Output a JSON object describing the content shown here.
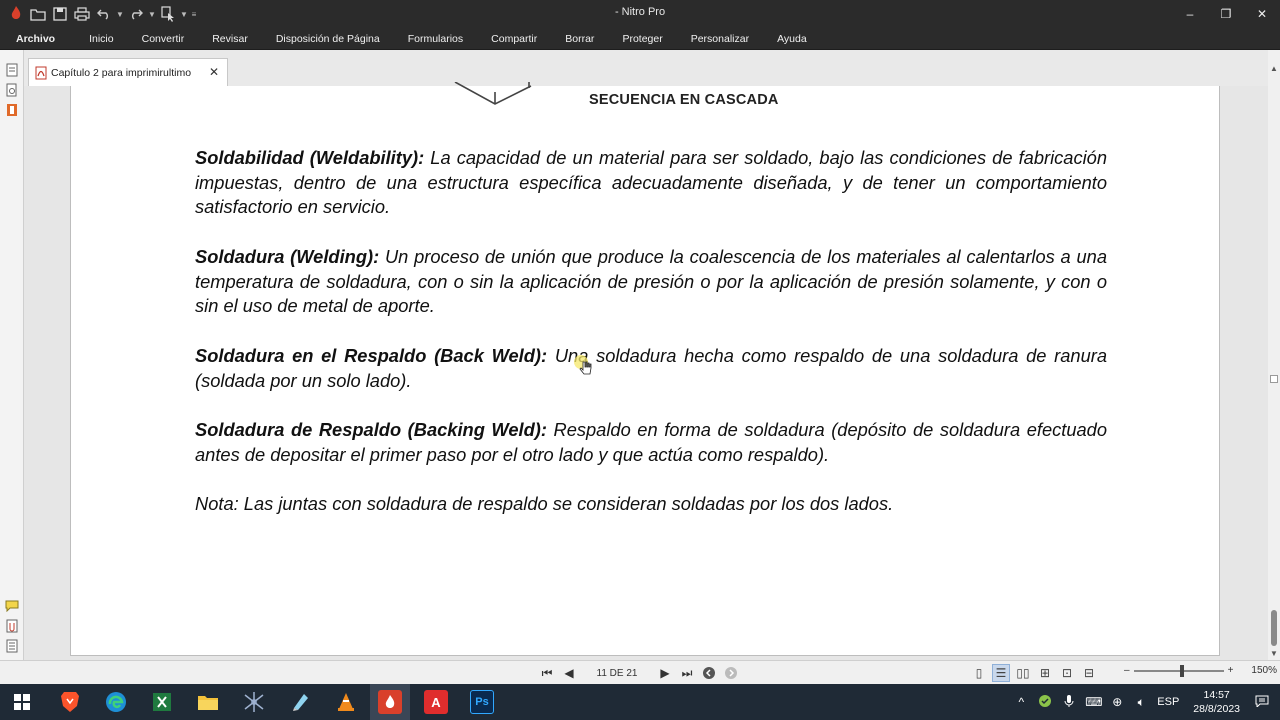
{
  "window": {
    "title": "- Nitro Pro",
    "minimize": "–",
    "restore": "❐",
    "close": "✕"
  },
  "quick_access": {
    "open_icon": "folder-icon",
    "save_icon": "save-icon",
    "print_icon": "print-icon",
    "undo_icon": "undo-icon",
    "redo_icon": "redo-icon",
    "select_icon": "select-tool-icon"
  },
  "menu": {
    "file": "Archivo",
    "items": [
      "Inicio",
      "Convertir",
      "Revisar",
      "Disposición de Página",
      "Formularios",
      "Compartir",
      "Borrar",
      "Proteger",
      "Personalizar",
      "Ayuda"
    ]
  },
  "tab": {
    "label": "Capítulo 2 para imprimirultimo",
    "close": "✕"
  },
  "document": {
    "caption": "SECUENCIA EN CASCADA",
    "paragraphs": [
      {
        "term": "Soldabilidad (Weldability):",
        "text": " La capacidad de un material para ser soldado, bajo las condiciones de fabricación impuestas, dentro de una estructura específica adecuadamente diseñada, y de tener un comportamiento satisfactorio en servicio."
      },
      {
        "term": "Soldadura (Welding):",
        "text": " Un proceso de unión que produce la coalescencia de los materiales al calentarlos a una temperatura de soldadura, con o sin la aplicación de presión o por la aplicación de presión solamente, y con o sin el uso de metal de aporte."
      },
      {
        "term": "Soldadura en el Respaldo (Back Weld):",
        "text": " Una soldadura hecha como respaldo de una soldadura de ranura (soldada por un solo lado)."
      },
      {
        "term": "Soldadura de Respaldo (Backing Weld):",
        "text": " Respaldo en forma de soldadura (depósito de soldadura efectuado antes de depositar el primer paso por el otro lado y que actúa como respaldo)."
      },
      {
        "term": "",
        "text": "Nota: Las juntas con soldadura de respaldo se consideran soldadas por los dos lados."
      }
    ]
  },
  "status": {
    "page_indicator": "11 DE 21",
    "zoom": "150%",
    "zoom_minus": "–",
    "zoom_plus": "+"
  },
  "taskbar": {
    "acrobat_label": "A",
    "photoshop_label": "Ps",
    "language": "ESP",
    "time": "14:57",
    "date": "28/8/2023"
  },
  "colors": {
    "titlebar": "#2b2b2b",
    "taskbar": "#1f2a36",
    "nitro_red": "#d9402b",
    "acrobat_red": "#e02d2d",
    "photoshop_blue": "#0a2a4f"
  }
}
